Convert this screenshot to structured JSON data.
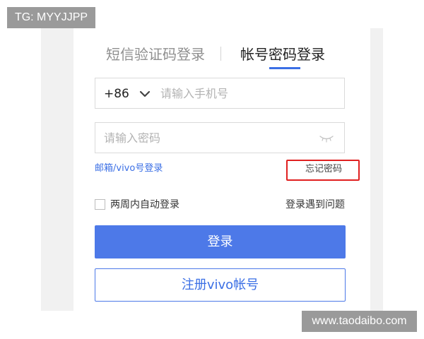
{
  "watermarks": {
    "top_left": "TG: MYYJJPP",
    "bottom_right": "www.taodaibo.com"
  },
  "tabs": {
    "sms_login": "短信验证码登录",
    "password_login": "帐号密码登录"
  },
  "phone": {
    "country_code": "+86",
    "placeholder": "请输入手机号"
  },
  "password": {
    "placeholder": "请输入密码"
  },
  "links": {
    "email_vivo_login": "邮箱/vivo号登录",
    "forgot_password": "忘记密码",
    "login_problem": "登录遇到问题"
  },
  "remember": {
    "label": "两周内自动登录"
  },
  "buttons": {
    "login": "登录",
    "register": "注册vivo帐号"
  },
  "colors": {
    "accent": "#4d79e8",
    "highlight": "#e02020"
  },
  "icons": {
    "country_dropdown": "chevron-down-icon",
    "password_visibility": "eye-closed-icon"
  }
}
